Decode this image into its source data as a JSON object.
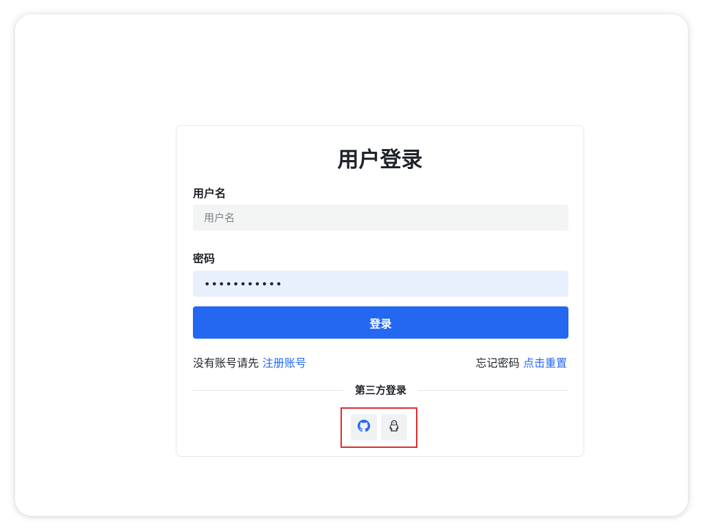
{
  "login_form": {
    "title": "用户登录",
    "username": {
      "label": "用户名",
      "placeholder": "用户名",
      "value": ""
    },
    "password": {
      "label": "密码",
      "value": "•••••••••••"
    },
    "submit_label": "登录",
    "register_prompt": "没有账号请先",
    "register_link": "注册账号",
    "forgot_prompt": "忘记密码",
    "reset_link": "点击重置",
    "third_party_label": "第三方登录",
    "third_party": [
      {
        "name": "github",
        "icon": "github-icon",
        "color": "#2468f2"
      },
      {
        "name": "qq",
        "icon": "qq-penguin-icon",
        "color": "#1f2329"
      }
    ]
  },
  "colors": {
    "primary": "#2468f2",
    "highlight_border": "#e02a2a",
    "password_field_bg": "#e8effd",
    "username_field_bg": "#f3f4f4"
  }
}
